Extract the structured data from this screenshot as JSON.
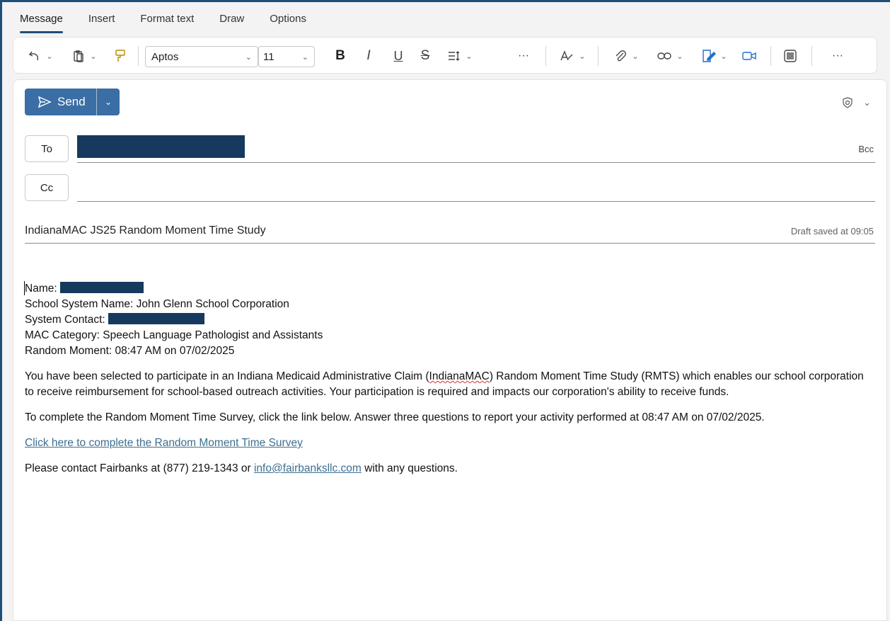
{
  "tabs": [
    "Message",
    "Insert",
    "Format text",
    "Draw",
    "Options"
  ],
  "ribbon": {
    "font_name": "Aptos",
    "font_size": "11",
    "bold": "B",
    "italic": "I",
    "underline": "U",
    "strike": "S",
    "more": "···",
    "more2": "···",
    "icons": [
      "undo-icon",
      "paste-icon",
      "format-painter-icon",
      "bold-icon",
      "italic-icon",
      "underline-icon",
      "strikethrough-icon",
      "paragraph-icon",
      "editor-icon",
      "attach-icon",
      "link-icon",
      "signature-icon",
      "meeting-icon",
      "apps-icon"
    ]
  },
  "compose": {
    "send_label": "Send",
    "to_label": "To",
    "cc_label": "Cc",
    "bcc_label": "Bcc",
    "subject": "IndianaMAC JS25 Random Moment Time Study",
    "draft_status": "Draft saved at 09:05"
  },
  "body": {
    "name_label": "Name: ",
    "school_system": "School System Name: John Glenn School Corporation",
    "system_contact_label": "System Contact: ",
    "mac_category": "MAC Category: Speech Language Pathologist and Assistants",
    "random_moment": "Random Moment: 08:47 AM on 07/02/2025",
    "para1_a": "You have been selected to participate in an Indiana Medicaid Administrative Claim (",
    "para1_misspelled": "IndianaMAC",
    "para1_b": ") Random Moment Time Study (RMTS) which enables our school corporation to receive reimbursement for school-based outreach activities. Your participation is required and impacts our corporation's ability to receive funds.",
    "para2": "To complete the Random Moment Time Survey, click the link below. Answer three questions to report your activity performed at 08:47 AM on 07/02/2025.",
    "survey_link": "Click here to complete the Random Moment Time Survey",
    "contact_a": "Please contact Fairbanks at (877) 219-1343 or ",
    "contact_email": "info@fairbanksllc.com",
    "contact_b": " with any questions."
  },
  "colors": {
    "accent": "#3b6ea5",
    "redaction": "#163a5f",
    "link": "#3d6e8f",
    "frame": "#1e4e7a"
  }
}
